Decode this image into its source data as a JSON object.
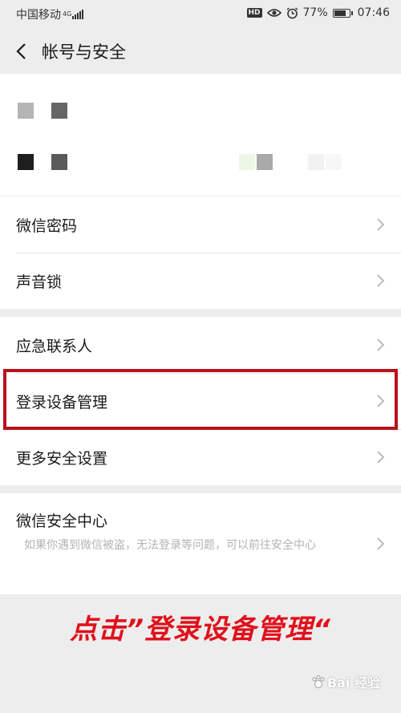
{
  "status_bar": {
    "carrier": "中国移动",
    "network": "4G",
    "hd": "HD",
    "battery": "77%",
    "battery_level": 0.77,
    "time": "07:46"
  },
  "nav": {
    "title": "帐号与安全"
  },
  "group1": {
    "items": [
      {
        "label": "微信密码"
      },
      {
        "label": "声音锁"
      }
    ]
  },
  "group2": {
    "items": [
      {
        "label": "应急联系人"
      },
      {
        "label": "登录设备管理"
      },
      {
        "label": "更多安全设置"
      }
    ]
  },
  "security_center": {
    "title": "微信安全中心",
    "description": "如果你遇到微信被盗，无法登录等问题，可以前往安全中心"
  },
  "annotation": "点击”登录设备管理“",
  "watermark": "Bai 经验",
  "colors": {
    "highlight": "#b8111b",
    "annotation": "#e0101b",
    "background": "#ededed"
  }
}
